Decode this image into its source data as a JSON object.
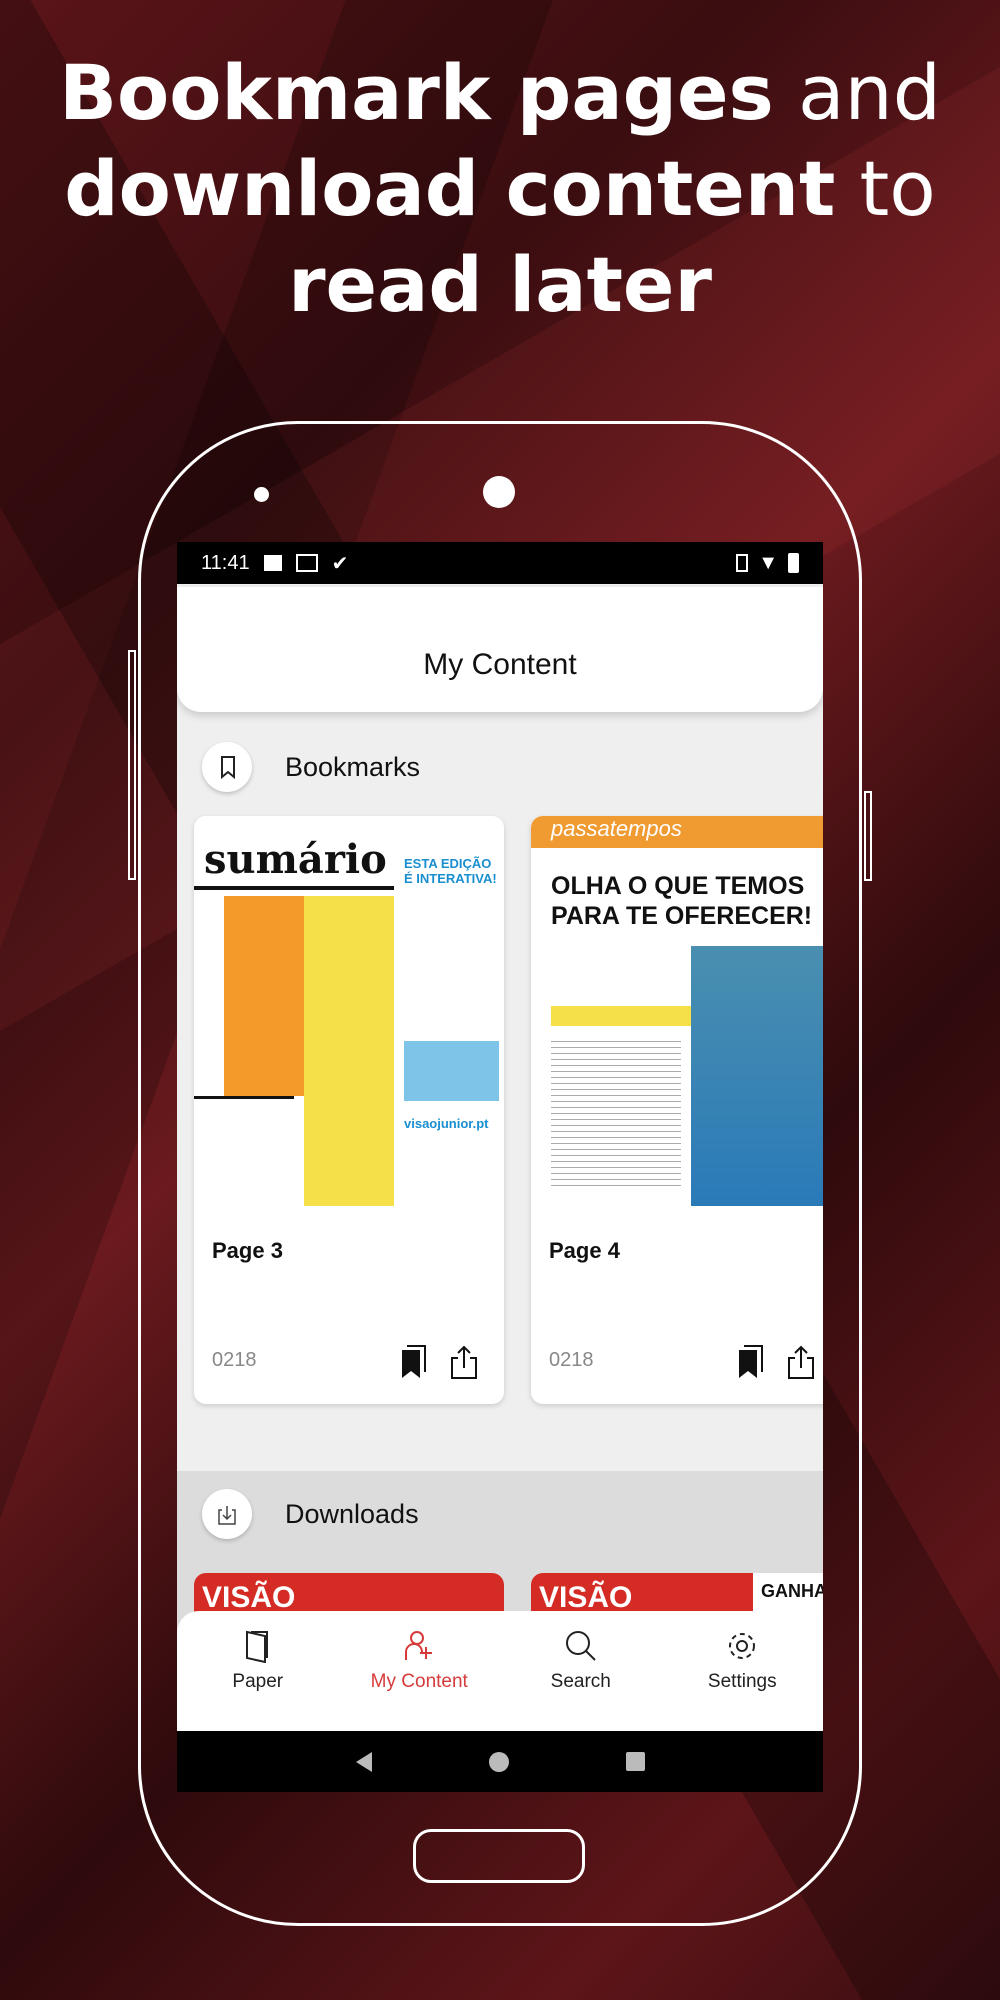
{
  "headline": {
    "bold1": "Bookmark pages",
    "rest1": " and",
    "line2_bold": "download content",
    "line2_rest": " to",
    "line3_bold": "read later"
  },
  "status": {
    "time": "11:41",
    "left_icons": [
      "image-icon",
      "gmail-icon",
      "check-icon"
    ],
    "right_icons": [
      "vibrate-icon",
      "wifi-icon",
      "battery-icon"
    ]
  },
  "header": {
    "title": "My Content"
  },
  "bookmarks": {
    "label": "Bookmarks",
    "items": [
      {
        "title": "Page 3",
        "issue": "0218",
        "cover_heading": "sumário",
        "cover_badge": "ESTA EDIÇÃO É INTERATIVA!",
        "cover_footer": "visaojunior.pt"
      },
      {
        "title": "Page 4",
        "issue": "0218",
        "cover_heading": "passatempos",
        "cover_headline": "OLHA O QUE TEMOS PARA TE OFERECER!"
      }
    ]
  },
  "downloads": {
    "label": "Downloads",
    "items": [
      {
        "cover_text": "VISÃO"
      },
      {
        "cover_text": "VISÃO",
        "badge": "GANHA!"
      }
    ]
  },
  "nav": {
    "items": [
      {
        "label": "Paper",
        "icon": "paper-icon"
      },
      {
        "label": "My Content",
        "icon": "add-user-icon",
        "active": true
      },
      {
        "label": "Search",
        "icon": "search-icon"
      },
      {
        "label": "Settings",
        "icon": "gear-icon"
      }
    ]
  },
  "colors": {
    "accent": "#d63b3b",
    "background": "#5a1418"
  }
}
